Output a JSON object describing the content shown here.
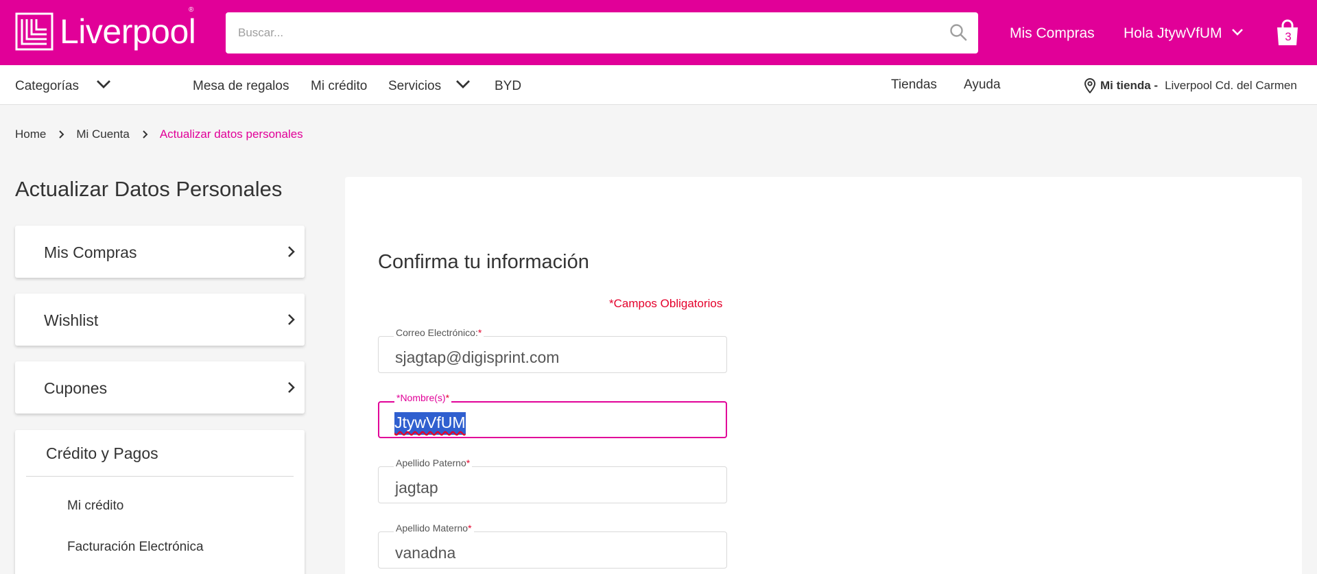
{
  "header": {
    "brand": "Liverpool",
    "search_placeholder": "Buscar...",
    "mis_compras": "Mis Compras",
    "greeting": "Hola JtywVfUM",
    "bag_count": "3"
  },
  "nav": {
    "categorias": "Categorías",
    "mesa_regalos": "Mesa de regalos",
    "mi_credito": "Mi crédito",
    "servicios": "Servicios",
    "byd": "BYD",
    "tiendas": "Tiendas",
    "ayuda": "Ayuda",
    "store_label": "Mi tienda -",
    "store_name": "Liverpool Cd. del Carmen"
  },
  "breadcrumb": {
    "home": "Home",
    "account": "Mi Cuenta",
    "current": "Actualizar datos personales"
  },
  "sidebar": {
    "title": "Actualizar Datos Personales",
    "items": [
      {
        "label": "Mis Compras"
      },
      {
        "label": "Wishlist"
      },
      {
        "label": "Cupones"
      }
    ],
    "credit": {
      "title": "Crédito y Pagos",
      "sub_items": [
        {
          "label": "Mi crédito"
        },
        {
          "label": "Facturación Electrónica"
        }
      ]
    }
  },
  "form": {
    "title": "Confirma tu información",
    "required_note": "*Campos Obligatorios",
    "fields": [
      {
        "label": "Correo Electrónico:",
        "required": "*",
        "value": "sjagtap@digisprint.com"
      },
      {
        "label": "*Nombre(s)",
        "required": "*",
        "value": "JtywVfUM"
      },
      {
        "label": "Apellido Paterno",
        "required": "*",
        "value": "jagtap"
      },
      {
        "label": "Apellido Materno",
        "required": "*",
        "value": "vanadna"
      }
    ]
  },
  "colors": {
    "brand_pink": "#e10098",
    "required_red": "#e4002b",
    "selection_blue": "#2f5fcf"
  }
}
